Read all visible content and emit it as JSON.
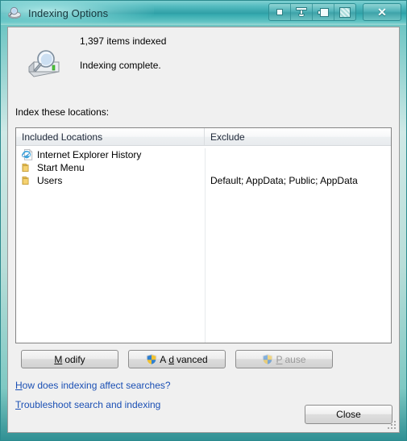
{
  "window": {
    "title": "Indexing Options",
    "app_icon": "magnifier-drive-icon",
    "title_buttons": [
      {
        "name": "minimize-button",
        "icon": "dot-icon"
      },
      {
        "name": "shade-button",
        "icon": "roll-up-icon"
      },
      {
        "name": "pin-button",
        "icon": "pin-icon"
      },
      {
        "name": "maximize-button",
        "icon": "maximize-icon"
      },
      {
        "name": "close-button",
        "icon": "close-x-icon",
        "label": "✕"
      }
    ],
    "accent_color": "#2f9fa6",
    "frame_color": "#9fd4d0",
    "client_bg": "#f0f0f0"
  },
  "status": {
    "icon": "indexing-drive-icon",
    "items_indexed": "1,397 items indexed",
    "state": "Indexing complete."
  },
  "locations": {
    "section_label": "Index these locations:",
    "columns": [
      "Included Locations",
      "Exclude"
    ],
    "rows": [
      {
        "icon": "internet-explorer-icon",
        "name": "Internet Explorer History",
        "exclude": ""
      },
      {
        "icon": "folder-icon",
        "name": "Start Menu",
        "exclude": ""
      },
      {
        "icon": "folder-icon",
        "name": "Users",
        "exclude": "Default; AppData; Public; AppData"
      }
    ]
  },
  "buttons": {
    "modify": {
      "label": "Modify",
      "accel_before": "",
      "accel": "M",
      "accel_after": "odify",
      "enabled": true,
      "shield": false
    },
    "advanced": {
      "label": "Advanced",
      "accel_before": "A",
      "accel": "d",
      "accel_after": "vanced",
      "enabled": true,
      "shield": true
    },
    "pause": {
      "label": "Pause",
      "accel_before": "",
      "accel": "P",
      "accel_after": "ause",
      "enabled": false,
      "shield": true
    },
    "close": {
      "label": "Close"
    }
  },
  "links": {
    "how": {
      "accel": "H",
      "rest": "ow does indexing affect searches?"
    },
    "troubleshoot": {
      "accel": "T",
      "rest": "roubleshoot search and indexing"
    }
  },
  "colors": {
    "link": "#1a4fb4",
    "disabled_text": "#9a9a9a",
    "shield_blue": "#2f7fd0",
    "shield_yellow": "#f2c230"
  }
}
